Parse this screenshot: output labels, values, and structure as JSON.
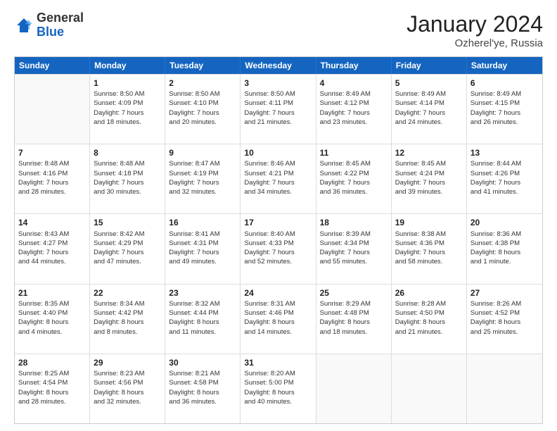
{
  "header": {
    "logo_general": "General",
    "logo_blue": "Blue",
    "month_title": "January 2024",
    "location": "Ozherel'ye, Russia"
  },
  "days_of_week": [
    "Sunday",
    "Monday",
    "Tuesday",
    "Wednesday",
    "Thursday",
    "Friday",
    "Saturday"
  ],
  "rows": [
    [
      {
        "day": "",
        "lines": []
      },
      {
        "day": "1",
        "lines": [
          "Sunrise: 8:50 AM",
          "Sunset: 4:09 PM",
          "Daylight: 7 hours",
          "and 18 minutes."
        ]
      },
      {
        "day": "2",
        "lines": [
          "Sunrise: 8:50 AM",
          "Sunset: 4:10 PM",
          "Daylight: 7 hours",
          "and 20 minutes."
        ]
      },
      {
        "day": "3",
        "lines": [
          "Sunrise: 8:50 AM",
          "Sunset: 4:11 PM",
          "Daylight: 7 hours",
          "and 21 minutes."
        ]
      },
      {
        "day": "4",
        "lines": [
          "Sunrise: 8:49 AM",
          "Sunset: 4:12 PM",
          "Daylight: 7 hours",
          "and 23 minutes."
        ]
      },
      {
        "day": "5",
        "lines": [
          "Sunrise: 8:49 AM",
          "Sunset: 4:14 PM",
          "Daylight: 7 hours",
          "and 24 minutes."
        ]
      },
      {
        "day": "6",
        "lines": [
          "Sunrise: 8:49 AM",
          "Sunset: 4:15 PM",
          "Daylight: 7 hours",
          "and 26 minutes."
        ]
      }
    ],
    [
      {
        "day": "7",
        "lines": [
          "Sunrise: 8:48 AM",
          "Sunset: 4:16 PM",
          "Daylight: 7 hours",
          "and 28 minutes."
        ]
      },
      {
        "day": "8",
        "lines": [
          "Sunrise: 8:48 AM",
          "Sunset: 4:18 PM",
          "Daylight: 7 hours",
          "and 30 minutes."
        ]
      },
      {
        "day": "9",
        "lines": [
          "Sunrise: 8:47 AM",
          "Sunset: 4:19 PM",
          "Daylight: 7 hours",
          "and 32 minutes."
        ]
      },
      {
        "day": "10",
        "lines": [
          "Sunrise: 8:46 AM",
          "Sunset: 4:21 PM",
          "Daylight: 7 hours",
          "and 34 minutes."
        ]
      },
      {
        "day": "11",
        "lines": [
          "Sunrise: 8:45 AM",
          "Sunset: 4:22 PM",
          "Daylight: 7 hours",
          "and 36 minutes."
        ]
      },
      {
        "day": "12",
        "lines": [
          "Sunrise: 8:45 AM",
          "Sunset: 4:24 PM",
          "Daylight: 7 hours",
          "and 39 minutes."
        ]
      },
      {
        "day": "13",
        "lines": [
          "Sunrise: 8:44 AM",
          "Sunset: 4:26 PM",
          "Daylight: 7 hours",
          "and 41 minutes."
        ]
      }
    ],
    [
      {
        "day": "14",
        "lines": [
          "Sunrise: 8:43 AM",
          "Sunset: 4:27 PM",
          "Daylight: 7 hours",
          "and 44 minutes."
        ]
      },
      {
        "day": "15",
        "lines": [
          "Sunrise: 8:42 AM",
          "Sunset: 4:29 PM",
          "Daylight: 7 hours",
          "and 47 minutes."
        ]
      },
      {
        "day": "16",
        "lines": [
          "Sunrise: 8:41 AM",
          "Sunset: 4:31 PM",
          "Daylight: 7 hours",
          "and 49 minutes."
        ]
      },
      {
        "day": "17",
        "lines": [
          "Sunrise: 8:40 AM",
          "Sunset: 4:33 PM",
          "Daylight: 7 hours",
          "and 52 minutes."
        ]
      },
      {
        "day": "18",
        "lines": [
          "Sunrise: 8:39 AM",
          "Sunset: 4:34 PM",
          "Daylight: 7 hours",
          "and 55 minutes."
        ]
      },
      {
        "day": "19",
        "lines": [
          "Sunrise: 8:38 AM",
          "Sunset: 4:36 PM",
          "Daylight: 7 hours",
          "and 58 minutes."
        ]
      },
      {
        "day": "20",
        "lines": [
          "Sunrise: 8:36 AM",
          "Sunset: 4:38 PM",
          "Daylight: 8 hours",
          "and 1 minute."
        ]
      }
    ],
    [
      {
        "day": "21",
        "lines": [
          "Sunrise: 8:35 AM",
          "Sunset: 4:40 PM",
          "Daylight: 8 hours",
          "and 4 minutes."
        ]
      },
      {
        "day": "22",
        "lines": [
          "Sunrise: 8:34 AM",
          "Sunset: 4:42 PM",
          "Daylight: 8 hours",
          "and 8 minutes."
        ]
      },
      {
        "day": "23",
        "lines": [
          "Sunrise: 8:32 AM",
          "Sunset: 4:44 PM",
          "Daylight: 8 hours",
          "and 11 minutes."
        ]
      },
      {
        "day": "24",
        "lines": [
          "Sunrise: 8:31 AM",
          "Sunset: 4:46 PM",
          "Daylight: 8 hours",
          "and 14 minutes."
        ]
      },
      {
        "day": "25",
        "lines": [
          "Sunrise: 8:29 AM",
          "Sunset: 4:48 PM",
          "Daylight: 8 hours",
          "and 18 minutes."
        ]
      },
      {
        "day": "26",
        "lines": [
          "Sunrise: 8:28 AM",
          "Sunset: 4:50 PM",
          "Daylight: 8 hours",
          "and 21 minutes."
        ]
      },
      {
        "day": "27",
        "lines": [
          "Sunrise: 8:26 AM",
          "Sunset: 4:52 PM",
          "Daylight: 8 hours",
          "and 25 minutes."
        ]
      }
    ],
    [
      {
        "day": "28",
        "lines": [
          "Sunrise: 8:25 AM",
          "Sunset: 4:54 PM",
          "Daylight: 8 hours",
          "and 28 minutes."
        ]
      },
      {
        "day": "29",
        "lines": [
          "Sunrise: 8:23 AM",
          "Sunset: 4:56 PM",
          "Daylight: 8 hours",
          "and 32 minutes."
        ]
      },
      {
        "day": "30",
        "lines": [
          "Sunrise: 8:21 AM",
          "Sunset: 4:58 PM",
          "Daylight: 8 hours",
          "and 36 minutes."
        ]
      },
      {
        "day": "31",
        "lines": [
          "Sunrise: 8:20 AM",
          "Sunset: 5:00 PM",
          "Daylight: 8 hours",
          "and 40 minutes."
        ]
      },
      {
        "day": "",
        "lines": []
      },
      {
        "day": "",
        "lines": []
      },
      {
        "day": "",
        "lines": []
      }
    ]
  ]
}
